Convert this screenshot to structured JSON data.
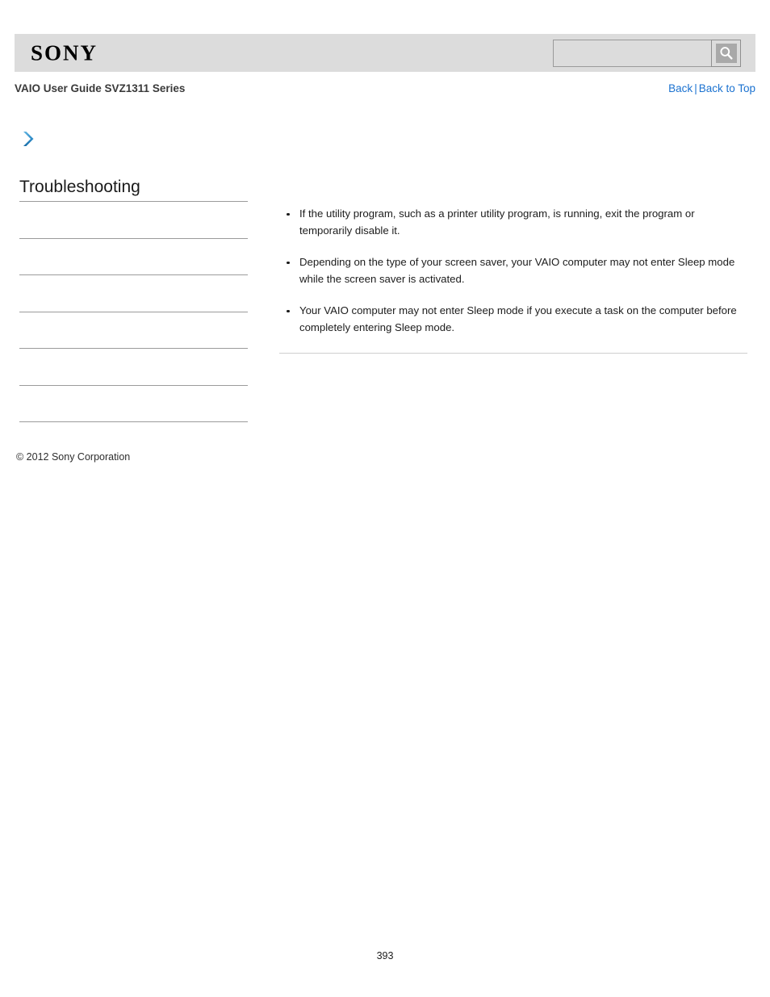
{
  "header": {
    "logo_text": "SONY",
    "search": {
      "value": "",
      "placeholder": "",
      "icon": "search-icon"
    }
  },
  "subheader": {
    "guide_title": "VAIO User Guide SVZ1311 Series",
    "links": {
      "back": "Back",
      "separator": "|",
      "back_to_top": "Back to Top"
    }
  },
  "sidebar": {
    "chevron_icon": "chevron-right-icon",
    "heading": "Troubleshooting",
    "items": [
      {
        "label": ""
      },
      {
        "label": ""
      },
      {
        "label": ""
      },
      {
        "label": ""
      },
      {
        "label": ""
      },
      {
        "label": ""
      }
    ],
    "copyright": "© 2012 Sony Corporation"
  },
  "main": {
    "bullets": [
      "If the utility program, such as a printer utility program, is running, exit the program or temporarily disable it.",
      "Depending on the type of your screen saver, your VAIO computer may not enter Sleep mode while the screen saver is activated.",
      "Your VAIO computer may not enter Sleep mode if you execute a task on the computer before completely entering Sleep mode."
    ]
  },
  "footer": {
    "page_number": "393"
  },
  "colors": {
    "header_background": "#dcdcdc",
    "link_blue": "#1b72d0",
    "chevron_blue": "#2e8bc7",
    "divider_gray": "#9b9b9b",
    "content_divider_gray": "#cfcfcf"
  }
}
